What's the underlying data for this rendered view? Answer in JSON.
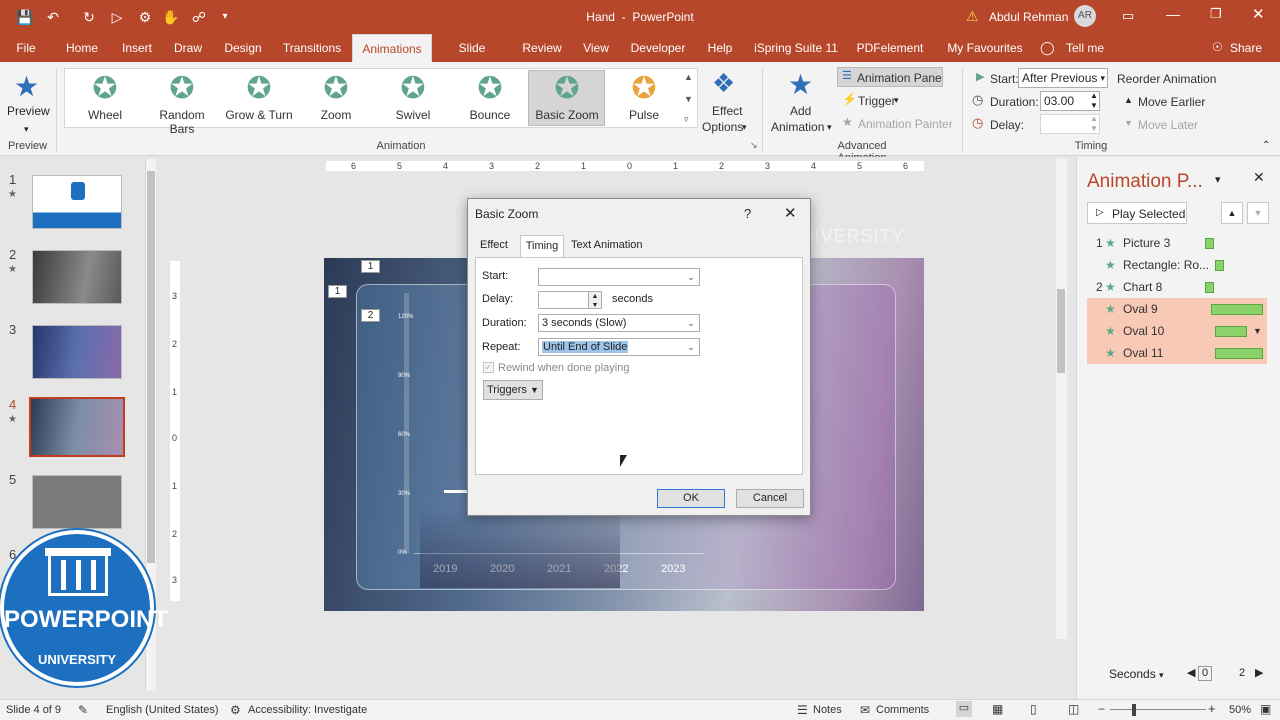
{
  "titlebar": {
    "doc_title": "Hand",
    "app_sep": "-",
    "app_name": "PowerPoint",
    "user_name": "Abdul Rehman",
    "user_initials": "AR"
  },
  "tabs": [
    "File",
    "Home",
    "Insert",
    "Draw",
    "Design",
    "Transitions",
    "Animations",
    "Slide Show",
    "Review",
    "View",
    "Developer",
    "Help",
    "iSpring Suite 11",
    "PDFelement",
    "My Favourites",
    "Tell me",
    "Share"
  ],
  "ribbon": {
    "preview_label": "Preview",
    "preview_group": "Preview",
    "animations": [
      "Wheel",
      "Random Bars",
      "Grow & Turn",
      "Zoom",
      "Swivel",
      "Bounce",
      "Basic Zoom",
      "Pulse"
    ],
    "animation_group": "Animation",
    "effect_options": [
      "Effect",
      "Options"
    ],
    "add_animation": [
      "Add",
      "Animation"
    ],
    "animation_pane": "Animation Pane",
    "trigger": "Trigger",
    "animation_painter": "Animation Painter",
    "advanced_group": "Advanced Animation",
    "start_label": "Start:",
    "start_value": "After Previous",
    "duration_label": "Duration:",
    "duration_value": "03.00",
    "delay_label": "Delay:",
    "reorder": "Reorder Animation",
    "move_earlier": "Move Earlier",
    "move_later": "Move Later",
    "timing_group": "Timing"
  },
  "ruler_top": [
    "6",
    "5",
    "4",
    "3",
    "2",
    "1",
    "0",
    "1",
    "2",
    "3",
    "4",
    "5",
    "6"
  ],
  "ruler_left": [
    "3",
    "2",
    "1",
    "0",
    "1",
    "2",
    "3"
  ],
  "slides": [
    {
      "num": "1",
      "star": "★"
    },
    {
      "num": "2",
      "star": "★"
    },
    {
      "num": "3",
      "star": ""
    },
    {
      "num": "4",
      "star": "★"
    },
    {
      "num": "5",
      "star": ""
    },
    {
      "num": "6",
      "star": ""
    }
  ],
  "slide_content": {
    "years": [
      "2019",
      "2020",
      "2021",
      "2022",
      "2023"
    ],
    "yticks": [
      "120%",
      "90%",
      "60%",
      "30%",
      "0%"
    ],
    "markers": [
      "1",
      "1",
      "2"
    ],
    "watermark": "POWERPOINT UNIVERSITY"
  },
  "dialog": {
    "title": "Basic Zoom",
    "help": "?",
    "tabs": [
      "Effect",
      "Timing",
      "Text Animation"
    ],
    "start_label": "Start:",
    "start_value": "",
    "delay_label": "Delay:",
    "delay_value": "",
    "delay_unit": "seconds",
    "duration_label": "Duration:",
    "duration_value": "3 seconds (Slow)",
    "repeat_label": "Repeat:",
    "repeat_value": "Until End of Slide",
    "rewind_label": "Rewind when done playing",
    "triggers": "Triggers",
    "ok": "OK",
    "cancel": "Cancel"
  },
  "animation_pane": {
    "title": "Animation P...",
    "play_selected": "Play Selected",
    "items": [
      {
        "num": "1",
        "label": "Picture 3",
        "bar_left": 118,
        "bar_width": 9,
        "highlight": false
      },
      {
        "num": "",
        "label": "Rectangle: Ro...",
        "bar_left": 128,
        "bar_width": 9,
        "highlight": false
      },
      {
        "num": "2",
        "label": "Chart 8",
        "bar_left": 118,
        "bar_width": 9,
        "highlight": false
      },
      {
        "num": "",
        "label": "Oval 9",
        "bar_left": 124,
        "bar_width": 52,
        "highlight": true
      },
      {
        "num": "",
        "label": "Oval 10",
        "bar_left": 128,
        "bar_width": 32,
        "highlight": true
      },
      {
        "num": "",
        "label": "Oval 11",
        "bar_left": 128,
        "bar_width": 48,
        "highlight": true
      }
    ],
    "seconds_label": "Seconds",
    "timeline_start": "0",
    "timeline_end": "2"
  },
  "status": {
    "slide": "Slide 4 of 9",
    "language": "English (United States)",
    "accessibility": "Accessibility: Investigate",
    "notes": "Notes",
    "comments": "Comments",
    "zoom": "50%"
  },
  "logo": {
    "line1": "POWERPOINT",
    "line2": "UNIVERSITY"
  },
  "colors": {
    "accent": "#b7472a",
    "anim_star": "#5fa58c",
    "bar_green": "#8bd26b",
    "highlight": "#f8c9b5"
  }
}
